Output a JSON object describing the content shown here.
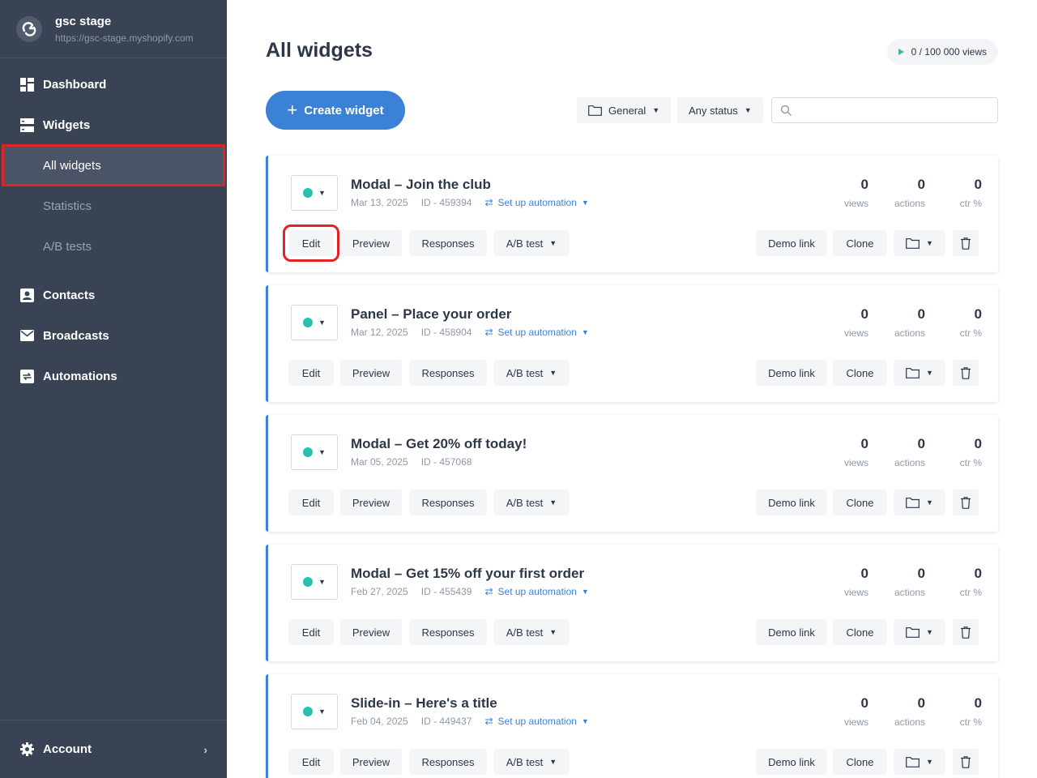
{
  "store": {
    "name": "gsc stage",
    "url": "https://gsc-stage.myshopify.com"
  },
  "nav": {
    "dashboard": "Dashboard",
    "widgets": "Widgets",
    "all_widgets": "All widgets",
    "statistics": "Statistics",
    "ab_tests": "A/B tests",
    "contacts": "Contacts",
    "broadcasts": "Broadcasts",
    "automations": "Automations",
    "account": "Account"
  },
  "page": {
    "title": "All widgets",
    "quota": "0 / 100 000 views",
    "create_label": "Create widget",
    "filter_folder": "General",
    "filter_status": "Any status",
    "search_placeholder": ""
  },
  "labels": {
    "views": "views",
    "actions": "actions",
    "ctr": "ctr %",
    "edit": "Edit",
    "preview": "Preview",
    "responses": "Responses",
    "ab_test": "A/B test",
    "demo_link": "Demo link",
    "clone": "Clone",
    "setup_automation": "Set up automation"
  },
  "colors": {
    "accent": "#3b82d6",
    "status_active": "#2bbfae",
    "sidebar": "#3a4354",
    "highlight": "#e02424"
  },
  "widgets": [
    {
      "title": "Modal – Join the club",
      "date": "Mar 13, 2025",
      "id": "ID - 459394",
      "automation": true,
      "views": "0",
      "actions": "0",
      "ctr": "0"
    },
    {
      "title": "Panel – Place your order",
      "date": "Mar 12, 2025",
      "id": "ID - 458904",
      "automation": true,
      "views": "0",
      "actions": "0",
      "ctr": "0"
    },
    {
      "title": "Modal – Get 20% off today!",
      "date": "Mar 05, 2025",
      "id": "ID - 457068",
      "automation": false,
      "views": "0",
      "actions": "0",
      "ctr": "0"
    },
    {
      "title": "Modal – Get 15% off your first order",
      "date": "Feb 27, 2025",
      "id": "ID - 455439",
      "automation": true,
      "views": "0",
      "actions": "0",
      "ctr": "0"
    },
    {
      "title": "Slide-in – Here's a title",
      "date": "Feb 04, 2025",
      "id": "ID - 449437",
      "automation": true,
      "views": "0",
      "actions": "0",
      "ctr": "0"
    }
  ]
}
